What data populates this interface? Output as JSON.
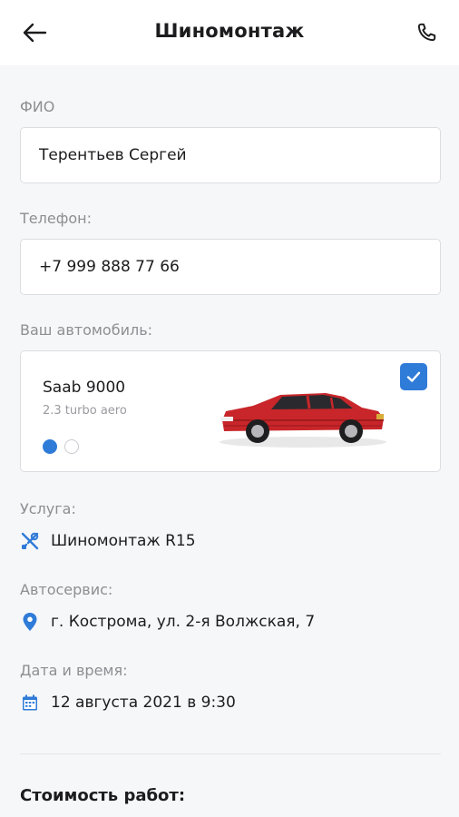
{
  "header": {
    "title": "Шиномонтаж",
    "back_icon": "arrow-left-icon",
    "phone_icon": "phone-icon"
  },
  "form": {
    "fio_label": "ФИО",
    "fio_value": "Терентьев Сергей",
    "phone_label": "Телефон:",
    "phone_value": "+7 999 888 77 66",
    "car_label": "Ваш автомобиль:"
  },
  "car": {
    "name": "Saab 9000",
    "trim": "2.3 turbo aero",
    "selected": true,
    "slides_total": 2,
    "slide_active": 1,
    "body_color": "#c8262a"
  },
  "service": {
    "label": "Услуга:",
    "value": "Шиномонтаж R15",
    "icon": "tools-icon"
  },
  "autoservice": {
    "label": "Автосервис:",
    "value": "г. Кострома, ул. 2-я Волжская, 7",
    "icon": "map-pin-icon"
  },
  "datetime": {
    "label": "Дата и время:",
    "value": "12 августа 2021 в 9:30",
    "icon": "calendar-icon"
  },
  "cost": {
    "title": "Стоимость работ:"
  },
  "colors": {
    "accent": "#2f7bd8",
    "background": "#f6f7f9",
    "text": "#1c1c1e",
    "muted": "#8e8e93"
  }
}
